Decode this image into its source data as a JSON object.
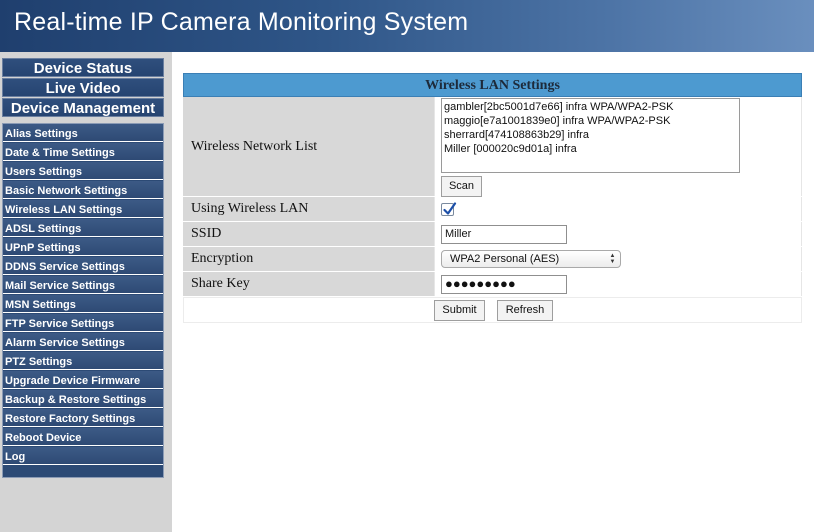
{
  "header": {
    "title": "Real-time IP Camera Monitoring System"
  },
  "main_nav": [
    {
      "label": "Device Status"
    },
    {
      "label": "Live Video"
    },
    {
      "label": "Device Management"
    }
  ],
  "sub_nav": [
    {
      "label": "Alias Settings"
    },
    {
      "label": "Date & Time Settings"
    },
    {
      "label": "Users Settings"
    },
    {
      "label": "Basic Network Settings"
    },
    {
      "label": "Wireless LAN Settings"
    },
    {
      "label": "ADSL Settings"
    },
    {
      "label": "UPnP Settings"
    },
    {
      "label": "DDNS Service Settings"
    },
    {
      "label": "Mail Service Settings"
    },
    {
      "label": "MSN Settings"
    },
    {
      "label": "FTP Service Settings"
    },
    {
      "label": "Alarm Service Settings"
    },
    {
      "label": "PTZ Settings"
    },
    {
      "label": "Upgrade Device Firmware"
    },
    {
      "label": "Backup & Restore Settings"
    },
    {
      "label": "Restore Factory Settings"
    },
    {
      "label": "Reboot Device"
    },
    {
      "label": "Log"
    }
  ],
  "wireless": {
    "title": "Wireless LAN Settings",
    "network_list_label": "Wireless Network List",
    "networks": [
      "gambler[2bc5001d7e66] infra WPA/WPA2-PSK",
      "maggio[e7a1001839e0] infra WPA/WPA2-PSK",
      "sherrard[474108863b29] infra",
      "Miller [000020c9d01a] infra"
    ],
    "scan_label": "Scan",
    "using_wireless_label": "Using Wireless LAN",
    "using_wireless_checked": true,
    "ssid_label": "SSID",
    "ssid_value": "Miller",
    "encryption_label": "Encryption",
    "encryption_value": "WPA2 Personal (AES)",
    "share_key_label": "Share Key",
    "share_key_masked": "●●●●●●●●●",
    "submit_label": "Submit",
    "refresh_label": "Refresh"
  },
  "colors": {
    "header_start": "#1f3f6e",
    "header_end": "#6a8fbe",
    "title_bar": "#4d9ad0",
    "nav_bg": "#2c4a75",
    "sidebar_bg": "#d4d4d4",
    "checkbox_check": "#1c4fa8"
  }
}
